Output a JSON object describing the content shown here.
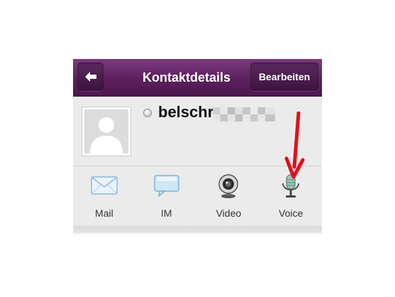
{
  "header": {
    "title": "Kontaktdetails",
    "edit_label": "Bearbeiten"
  },
  "contact": {
    "name": "belschr"
  },
  "actions": [
    {
      "label": "Mail",
      "icon": "envelope-icon"
    },
    {
      "label": "IM",
      "icon": "chat-bubble-icon"
    },
    {
      "label": "Video",
      "icon": "webcam-icon"
    },
    {
      "label": "Voice",
      "icon": "microphone-icon"
    }
  ],
  "colors": {
    "header_purple": "#5b1f5d",
    "annotation_arrow": "#e0101a"
  }
}
